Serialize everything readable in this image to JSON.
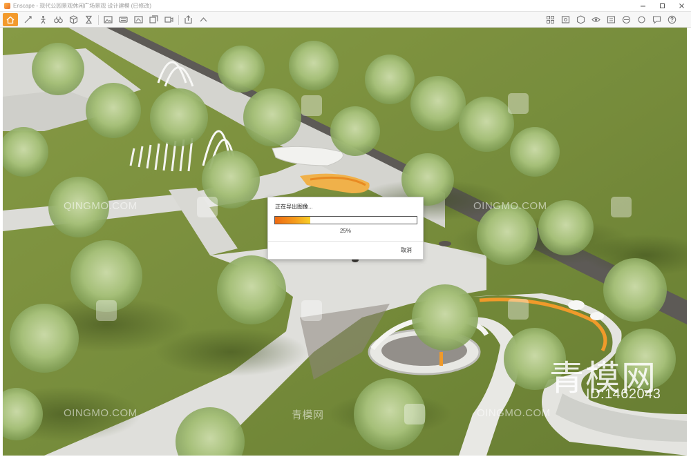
{
  "window": {
    "title": "Enscape - 现代公园景观休闲广场景观 设计建模 (已修改)",
    "controls": [
      "minimize",
      "maximize",
      "close"
    ]
  },
  "toolbar": {
    "home_icon": "home-icon",
    "left_icons": [
      "capture-icon",
      "walk-icon",
      "binoculars-icon",
      "cube-icon",
      "hourglass-icon",
      "image-icon",
      "panorama-icon",
      "screenshot-icon",
      "batch-render-icon",
      "video-icon",
      "export-icon",
      "upload-icon"
    ],
    "right_icons": [
      "asset-library-icon",
      "settings-icon",
      "visual-settings-icon",
      "eye-icon",
      "info-icon",
      "help-icon",
      "sync-icon",
      "feedback-icon",
      "question-icon"
    ],
    "accent": "#f39a2c"
  },
  "export_dialog": {
    "title": "正在导出图像...",
    "progress_percent": 25,
    "progress_label": "25%",
    "cancel_label": "取消"
  },
  "watermarks": {
    "logo_text": "青模网",
    "site_text": "QINGMO.COM",
    "site_text_alt": "OINGMO.COM",
    "big_text": "青模网",
    "id_text": "ID:1462043"
  }
}
